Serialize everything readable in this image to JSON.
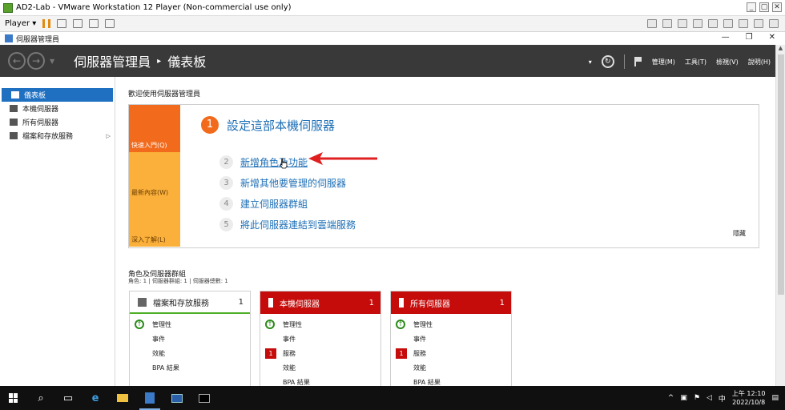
{
  "vmware": {
    "title": "AD2-Lab - VMware Workstation 12 Player (Non-commercial use only)",
    "player_menu": "Player ▾",
    "window_controls": [
      "_",
      "▢",
      "✕"
    ]
  },
  "window": {
    "title": "伺服器管理員",
    "controls": [
      "—",
      "❐",
      "✕"
    ]
  },
  "header": {
    "breadcrumb_app": "伺服器管理員",
    "breadcrumb_sep": "▸",
    "breadcrumb_page": "儀表板",
    "menus": [
      "管理(M)",
      "工具(T)",
      "檢視(V)",
      "說明(H)"
    ]
  },
  "sidebar": {
    "items": [
      {
        "label": "儀表板",
        "icon": "dashboard-icon",
        "active": true
      },
      {
        "label": "本機伺服器",
        "icon": "server-icon"
      },
      {
        "label": "所有伺服器",
        "icon": "servers-icon"
      },
      {
        "label": "檔案和存放服務",
        "icon": "file-storage-icon",
        "expand": "▷"
      }
    ]
  },
  "main": {
    "welcome": "歡迎使用伺服器管理員",
    "quick_start": {
      "tabs": [
        "快速入門(Q)",
        "最新內容(W)",
        "深入了解(L)"
      ],
      "title_num": "1",
      "title": "設定這部本機伺服器",
      "steps": [
        {
          "num": "2",
          "label": "新增角色及功能"
        },
        {
          "num": "3",
          "label": "新增其他要管理的伺服器"
        },
        {
          "num": "4",
          "label": "建立伺服器群組"
        },
        {
          "num": "5",
          "label": "將此伺服器連結到雲端服務"
        }
      ],
      "hide": "隱藏"
    },
    "roles": {
      "title": "角色及伺服器群組",
      "subtitle": "角色: 1 | 伺服器群組: 1 | 伺服器總數: 1",
      "cards": [
        {
          "title": "檔案和存放服務",
          "count": "1",
          "rows": [
            {
              "label": "管理性",
              "status": "ok"
            },
            {
              "label": "事件"
            },
            {
              "label": "效能"
            },
            {
              "label": "BPA 結果"
            }
          ]
        },
        {
          "title": "本機伺服器",
          "count": "1",
          "rows": [
            {
              "label": "管理性",
              "status": "ok"
            },
            {
              "label": "事件"
            },
            {
              "label": "服務",
              "badge": "1"
            },
            {
              "label": "效能"
            },
            {
              "label": "BPA 結果"
            }
          ]
        },
        {
          "title": "所有伺服器",
          "count": "1",
          "rows": [
            {
              "label": "管理性",
              "status": "ok"
            },
            {
              "label": "事件"
            },
            {
              "label": "服務",
              "badge": "1"
            },
            {
              "label": "效能"
            },
            {
              "label": "BPA 結果"
            }
          ]
        }
      ]
    }
  },
  "taskbar": {
    "tray_chevron": "^",
    "ime": "中",
    "time": "上午 12:10",
    "date": "2022/10/8"
  },
  "colors": {
    "accent_blue": "#1f70c1",
    "orange": "#f26a1b",
    "yellow": "#fbb03b",
    "red": "#c60b0b",
    "green": "#4caf25",
    "header_dark": "#393939"
  }
}
